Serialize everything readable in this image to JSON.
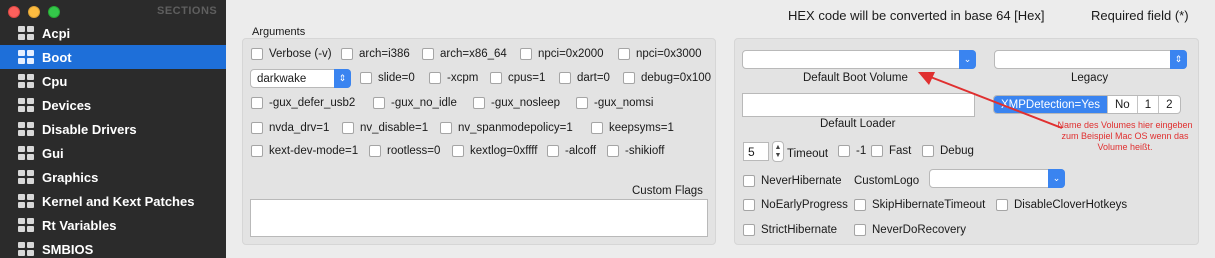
{
  "sidebar": {
    "title": "SECTIONS",
    "items": [
      {
        "label": "Acpi"
      },
      {
        "label": "Boot"
      },
      {
        "label": "Cpu"
      },
      {
        "label": "Devices"
      },
      {
        "label": "Disable Drivers"
      },
      {
        "label": "Gui"
      },
      {
        "label": "Graphics"
      },
      {
        "label": "Kernel and Kext Patches"
      },
      {
        "label": "Rt Variables"
      },
      {
        "label": "SMBIOS"
      }
    ]
  },
  "header": {
    "hex_note": "HEX code will be converted in base 64 [Hex]",
    "required_note": "Required field (*)"
  },
  "arguments": {
    "title": "Arguments",
    "row1": [
      "Verbose (-v)",
      "arch=i386",
      "arch=x86_64",
      "npci=0x2000",
      "npci=0x3000"
    ],
    "darkwake": "darkwake",
    "row2": [
      "slide=0",
      "-xcpm",
      "cpus=1",
      "dart=0",
      "debug=0x100"
    ],
    "row3": [
      "-gux_defer_usb2",
      "-gux_no_idle",
      "-gux_nosleep",
      "-gux_nomsi"
    ],
    "row4": [
      "nvda_drv=1",
      "nv_disable=1",
      "nv_spanmodepolicy=1",
      "keepsyms=1"
    ],
    "row5": [
      "kext-dev-mode=1",
      "rootless=0",
      "kextlog=0xffff",
      "-alcoff",
      "-shikioff"
    ],
    "custom_flags": "Custom Flags"
  },
  "right": {
    "default_boot_volume": "Default Boot Volume",
    "legacy": "Legacy",
    "default_loader": "Default Loader",
    "xmp": [
      "XMPDetection=Yes",
      "No",
      "1",
      "2"
    ],
    "timeout_value": "5",
    "timeout_label": "Timeout",
    "timeout_opts": [
      "-1",
      "Fast",
      "Debug"
    ],
    "never_hibernate": "NeverHibernate",
    "custom_logo": "CustomLogo",
    "no_early_progress": "NoEarlyProgress",
    "skip_hibernate_timeout": "SkipHibernateTimeout",
    "disable_clover_hotkeys": "DisableCloverHotkeys",
    "strict_hibernate": "StrictHibernate",
    "never_do_recovery": "NeverDoRecovery"
  },
  "annotation": {
    "text": "Name des Volumes hier eingeben zum Beispiel Mac OS wenn das Volume heißt.",
    "color": "#e03030"
  },
  "colors": {
    "sidebar_bg": "#2b2b2b",
    "selection": "#1e6fd9",
    "accent": "#3a84f0"
  },
  "icons": {
    "nav": "grid-icon",
    "popup": "chevron-updown-icon"
  }
}
